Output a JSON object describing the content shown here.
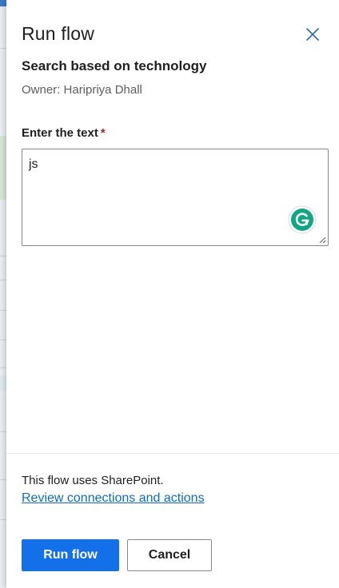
{
  "panel": {
    "title": "Run flow",
    "close_icon": "close-icon"
  },
  "flow": {
    "name": "Search based on technology",
    "owner": "Owner: Haripriya Dhall"
  },
  "input": {
    "label": "Enter the text",
    "required_mark": "*",
    "value": "js",
    "assistant_icon": "grammarly-icon"
  },
  "footer": {
    "uses_text": "This flow uses SharePoint.",
    "review_link": "Review connections and actions",
    "run_label": "Run flow",
    "cancel_label": "Cancel"
  },
  "colors": {
    "primary": "#1370e8",
    "link": "#0f6cbd",
    "required": "#a4262c",
    "grammarly": "#15c39a"
  }
}
